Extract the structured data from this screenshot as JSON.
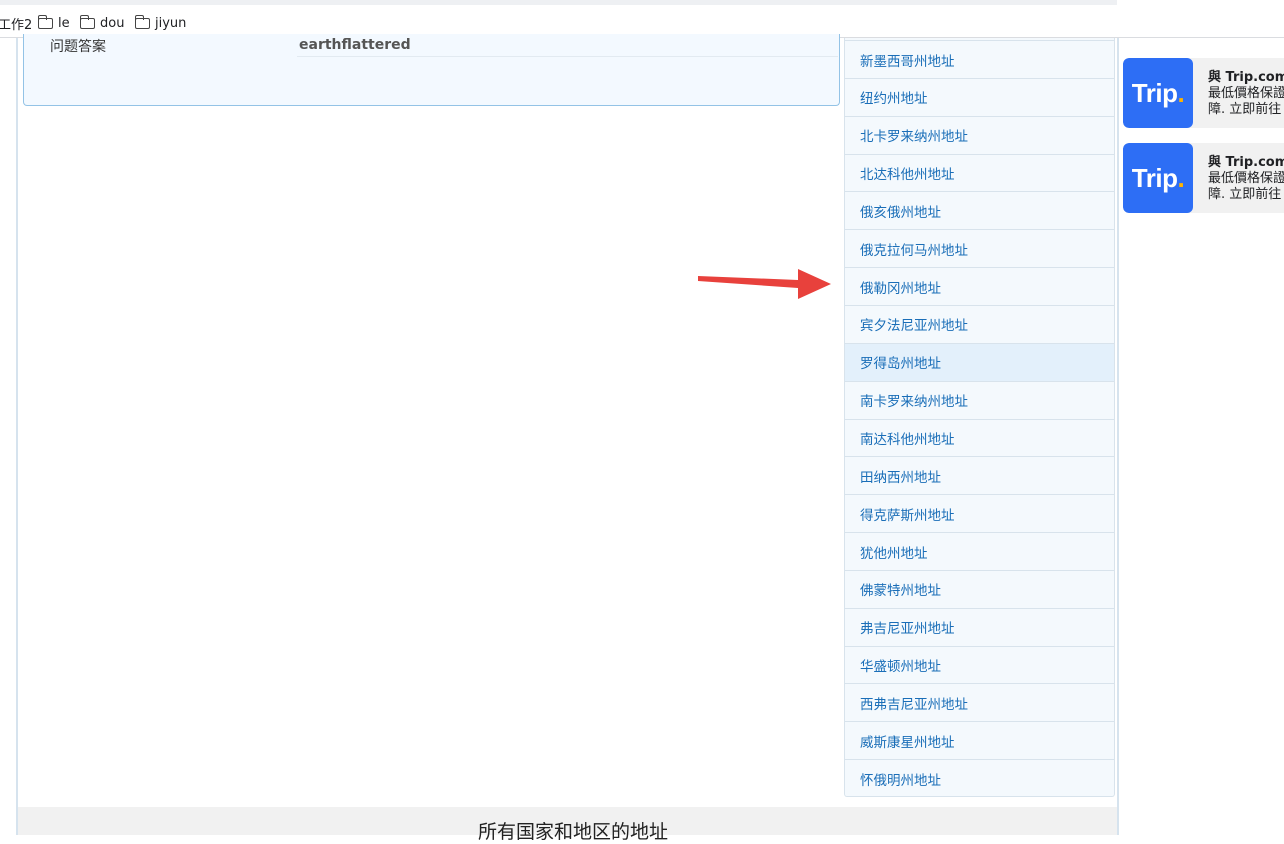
{
  "bookmarks": [
    {
      "label": "工作2",
      "folder": false
    },
    {
      "label": "le",
      "folder": true
    },
    {
      "label": "dou",
      "folder": true
    },
    {
      "label": "jiyun",
      "folder": true
    }
  ],
  "qa": {
    "label": "问题答案",
    "value": "earthflattered"
  },
  "states": [
    "新墨西哥州地址",
    "纽约州地址",
    "北卡罗来纳州地址",
    "北达科他州地址",
    "俄亥俄州地址",
    "俄克拉何马州地址",
    "俄勒冈州地址",
    "宾夕法尼亚州地址",
    "罗得岛州地址",
    "南卡罗来纳州地址",
    "南达科他州地址",
    "田纳西州地址",
    "得克萨斯州地址",
    "犹他州地址",
    "佛蒙特州地址",
    "弗吉尼亚州地址",
    "华盛顿州地址",
    "西弗吉尼亚州地址",
    "威斯康星州地址",
    "怀俄明州地址"
  ],
  "active_state": "罗得岛州地址",
  "footer_title": "所有国家和地区的地址",
  "ads": [
    {
      "logo": "Trip",
      "line1": "與 Trip.com",
      "line2": "最低價格保證",
      "line3": "障. 立即前往"
    },
    {
      "logo": "Trip",
      "line1": "與 Trip.com",
      "line2": "最低價格保證",
      "line3": "障. 立即前往"
    }
  ],
  "colors": {
    "link": "#1a6eb8",
    "arrow": "#e8413c",
    "trip_blue": "#2d6ef5",
    "trip_dot": "#ffb400"
  }
}
